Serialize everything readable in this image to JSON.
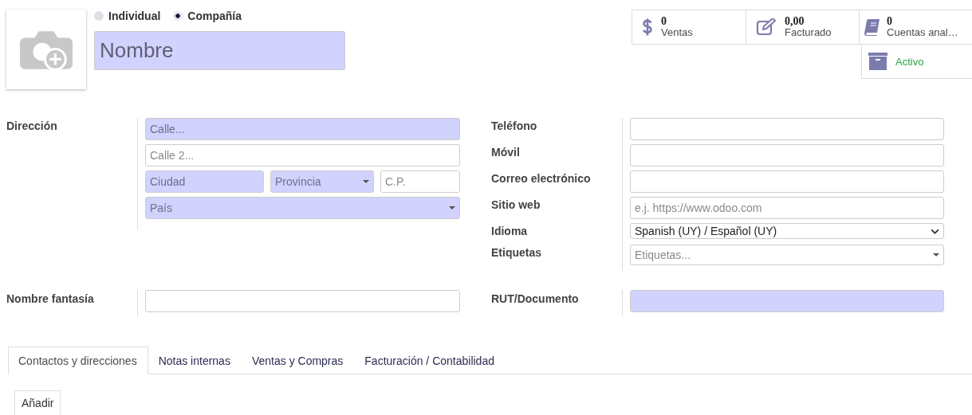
{
  "partner_type": [
    {
      "label": "Individual",
      "selected": false
    },
    {
      "label": "Compañía",
      "selected": true
    }
  ],
  "name": {
    "placeholder": "Nombre",
    "required": true
  },
  "stat_buttons": [
    {
      "kind": "sales",
      "value": "0",
      "label": "Ventas"
    },
    {
      "kind": "invoiced",
      "value": "0,00",
      "label": "Facturado"
    },
    {
      "kind": "accounts",
      "value": "0",
      "label": "Cuentas anal…"
    }
  ],
  "archive_button": {
    "label": "Activo",
    "active": true
  },
  "address": {
    "label": "Dirección",
    "rows": [
      [
        {
          "placeholder": "Calle...",
          "required": true,
          "kind": "input"
        }
      ],
      [
        {
          "placeholder": "Calle 2...",
          "required": false,
          "kind": "input"
        }
      ],
      [
        {
          "placeholder": "Ciudad",
          "required": true,
          "kind": "input"
        },
        {
          "placeholder": "Provincia",
          "required": true,
          "kind": "dropdown"
        },
        {
          "placeholder": "C.P.",
          "required": false,
          "kind": "input"
        }
      ],
      [
        {
          "placeholder": "País",
          "required": true,
          "kind": "dropdown"
        }
      ]
    ]
  },
  "contact_fields": [
    {
      "label": "Teléfono",
      "kind": "input",
      "required": false
    },
    {
      "label": "Móvil",
      "kind": "input",
      "required": false
    },
    {
      "label": "Correo electrónico",
      "kind": "input",
      "required": false
    },
    {
      "label": "Sitio web",
      "kind": "input",
      "required": false,
      "placeholder": "e.j. https://www.odoo.com"
    },
    {
      "label": "Idioma",
      "kind": "select",
      "required": false,
      "value": "Spanish (UY) / Español (UY)"
    },
    {
      "label": "Etiquetas",
      "kind": "dropdown",
      "required": false,
      "placeholder": "Etiquetas..."
    }
  ],
  "trade_name": {
    "label": "Nombre fantasía",
    "required": false
  },
  "rut": {
    "label": "RUT/Documento",
    "required": true
  },
  "tabs": [
    {
      "label": "Contactos y direcciones",
      "selected": true
    },
    {
      "label": "Notas internas",
      "selected": false
    },
    {
      "label": "Ventas y Compras",
      "selected": false
    },
    {
      "label": "Facturación / Contabilidad",
      "selected": false
    }
  ],
  "add_button": "Añadir"
}
